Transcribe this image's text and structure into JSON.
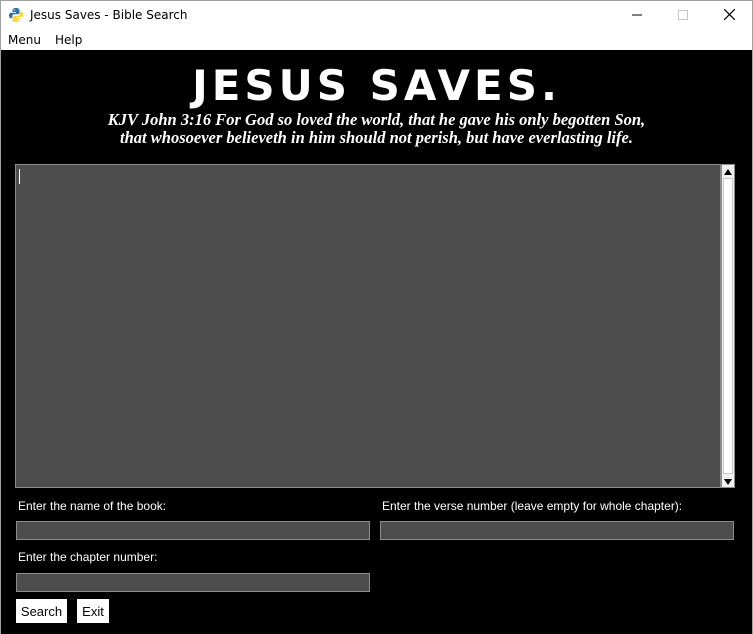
{
  "window": {
    "title": "Jesus Saves - Bible Search"
  },
  "menubar": {
    "items": [
      {
        "label": "Menu"
      },
      {
        "label": "Help"
      }
    ]
  },
  "header": {
    "heading": "JESUS SAVES.",
    "verse_line1": "KJV John 3:16 For God so loved the world, that he gave his only begotten Son,",
    "verse_line2": "that whosoever believeth in him should not perish, but have everlasting life."
  },
  "output": {
    "text": ""
  },
  "form": {
    "book_label": "Enter the name of the book:",
    "book_value": "",
    "verse_label": "Enter the verse number (leave empty for whole chapter):",
    "verse_value": "",
    "chapter_label": "Enter the chapter number:",
    "chapter_value": ""
  },
  "buttons": {
    "search_label": "Search",
    "exit_label": "Exit"
  },
  "colors": {
    "background": "#000000",
    "text_area": "#4d4d4d",
    "foreground": "#ffffff"
  }
}
